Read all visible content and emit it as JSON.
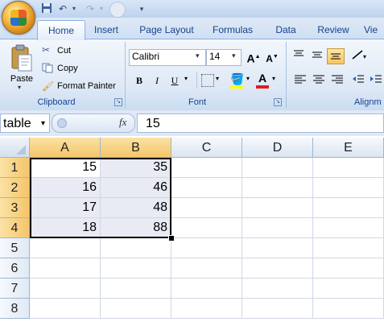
{
  "ribbon": {
    "tabs": [
      "Home",
      "Insert",
      "Page Layout",
      "Formulas",
      "Data",
      "Review",
      "Vie"
    ],
    "clipboard": {
      "paste": "Paste",
      "cut": "Cut",
      "copy": "Copy",
      "format_painter": "Format Painter",
      "label": "Clipboard"
    },
    "font": {
      "name": "Calibri",
      "size": "14",
      "grow": "A",
      "shrink": "A",
      "bold": "B",
      "italic": "I",
      "underline": "U",
      "font_color_letter": "A",
      "label": "Font"
    },
    "alignment": {
      "label": "Alignm"
    }
  },
  "formula_bar": {
    "name_box": "table",
    "fx": "fx",
    "value": "15"
  },
  "sheet": {
    "columns": [
      "A",
      "B",
      "C",
      "D",
      "E"
    ],
    "rows": [
      "1",
      "2",
      "3",
      "4",
      "5",
      "6",
      "7",
      "8"
    ],
    "cells": [
      [
        "15",
        "35"
      ],
      [
        "16",
        "46"
      ],
      [
        "17",
        "48"
      ],
      [
        "18",
        "88"
      ]
    ]
  },
  "colors": {
    "selection_fill": "#e8eaf4",
    "selected_header": "#f5c569",
    "ribbon_blue": "#15428b"
  }
}
